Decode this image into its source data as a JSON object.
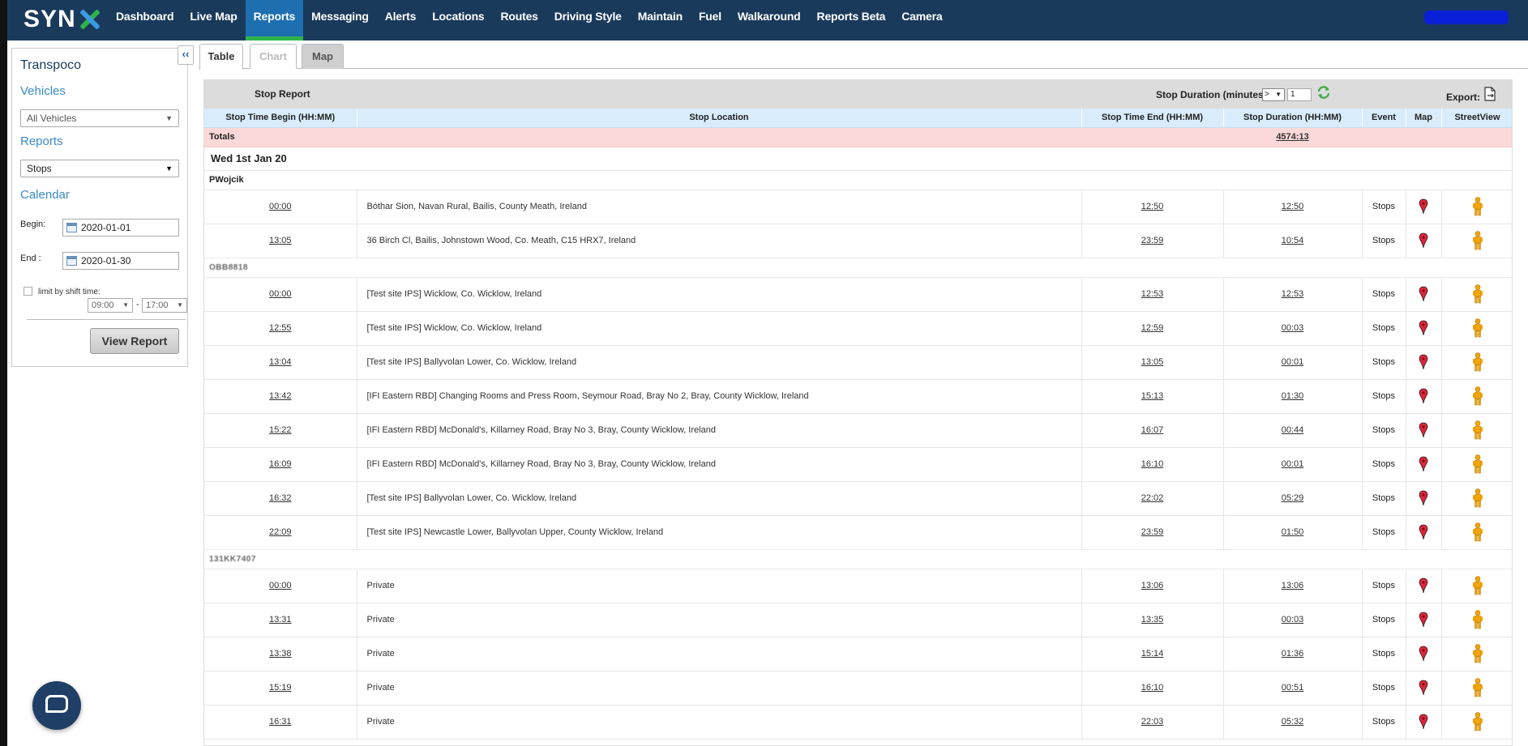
{
  "app": {
    "logo_text": "SYN",
    "nav": [
      "Dashboard",
      "Live Map",
      "Reports",
      "Messaging",
      "Alerts",
      "Locations",
      "Routes",
      "Driving Style",
      "Maintain",
      "Fuel",
      "Walkaround",
      "Reports Beta",
      "Camera"
    ],
    "active_nav": "Reports",
    "colors": {
      "nav_bg": "#1a3a5c",
      "active_tab": "#1d6fb0",
      "active_underline": "#2eb34a",
      "accent_text": "#3a8ac6",
      "totals_bg": "#fcd9d9",
      "header_bg": "#d9ecfb"
    }
  },
  "sidebar": {
    "collapse_label": "‹‹",
    "title": "Transpoco",
    "vehicles_label": "Vehicles",
    "vehicles_value": "All Vehicles",
    "reports_label": "Reports",
    "reports_value": "Stops",
    "calendar_label": "Calendar",
    "begin_label": "Begin:",
    "begin_value": "2020-01-01",
    "end_label": "End :",
    "end_value": "2020-01-30",
    "shift_label": "limit by shift time:",
    "shift_start": "09:00",
    "shift_end": "17:00",
    "view_button": "View Report"
  },
  "tabs": {
    "table": "Table",
    "chart": "Chart",
    "map": "Map"
  },
  "report": {
    "title": "Stop Report",
    "duration_label": "Stop Duration (minutes)",
    "duration_operator": ">",
    "duration_value": "1",
    "export_label": "Export:",
    "columns": [
      "Stop Time Begin (HH:MM)",
      "Stop Location",
      "Stop Time End (HH:MM)",
      "Stop Duration (HH:MM)",
      "Event",
      "Map",
      "StreetView"
    ],
    "totals_label": "Totals",
    "totals_duration": "4574:13",
    "date": "Wed 1st Jan 20",
    "groups": [
      {
        "driver": "PWojcik",
        "rows": [
          {
            "begin": "00:00",
            "location": "Bóthar Sion, Navan Rural, Bailis, County Meath, Ireland",
            "end": "12:50",
            "duration": "12:50",
            "event": "Stops"
          },
          {
            "begin": "13:05",
            "location": "36 Birch Cl, Bailis, Johnstown Wood, Co. Meath, C15 HRX7, Ireland",
            "end": "23:59",
            "duration": "10:54",
            "event": "Stops"
          }
        ]
      },
      {
        "driver": "OBB8818",
        "rows": [
          {
            "begin": "00:00",
            "location": "[Test site IPS] Wicklow, Co. Wicklow, Ireland",
            "end": "12:53",
            "duration": "12:53",
            "event": "Stops"
          },
          {
            "begin": "12:55",
            "location": "[Test site IPS] Wicklow, Co. Wicklow, Ireland",
            "end": "12:59",
            "duration": "00:03",
            "event": "Stops"
          },
          {
            "begin": "13:04",
            "location": "[Test site IPS] Ballyvolan Lower, Co. Wicklow, Ireland",
            "end": "13:05",
            "duration": "00:01",
            "event": "Stops"
          },
          {
            "begin": "13:42",
            "location": "[IFI Eastern RBD] Changing Rooms and Press Room, Seymour Road, Bray No 2, Bray, County Wicklow, Ireland",
            "end": "15:13",
            "duration": "01:30",
            "event": "Stops"
          },
          {
            "begin": "15:22",
            "location": "[IFI Eastern RBD] McDonald's, Killarney Road, Bray No 3, Bray, County Wicklow, Ireland",
            "end": "16:07",
            "duration": "00:44",
            "event": "Stops"
          },
          {
            "begin": "16:09",
            "location": "[IFI Eastern RBD] McDonald's, Killarney Road, Bray No 3, Bray, County Wicklow, Ireland",
            "end": "16:10",
            "duration": "00:01",
            "event": "Stops"
          },
          {
            "begin": "16:32",
            "location": "[Test site IPS] Ballyvolan Lower, Co. Wicklow, Ireland",
            "end": "22:02",
            "duration": "05:29",
            "event": "Stops"
          },
          {
            "begin": "22:09",
            "location": "[Test site IPS] Newcastle Lower, Ballyvolan Upper, County Wicklow, Ireland",
            "end": "23:59",
            "duration": "01:50",
            "event": "Stops"
          }
        ]
      },
      {
        "driver": "131KK7407",
        "rows": [
          {
            "begin": "00:00",
            "location": "Private",
            "end": "13:06",
            "duration": "13:06",
            "event": "Stops"
          },
          {
            "begin": "13:31",
            "location": "Private",
            "end": "13:35",
            "duration": "00:03",
            "event": "Stops"
          },
          {
            "begin": "13:38",
            "location": "Private",
            "end": "15:14",
            "duration": "01:36",
            "event": "Stops"
          },
          {
            "begin": "15:19",
            "location": "Private",
            "end": "16:10",
            "duration": "00:51",
            "event": "Stops"
          },
          {
            "begin": "16:31",
            "location": "Private",
            "end": "22:03",
            "duration": "05:32",
            "event": "Stops"
          }
        ]
      }
    ]
  },
  "icons": {
    "map": "map-pin-icon",
    "streetview": "pegman-icon",
    "refresh": "refresh-icon",
    "export": "export-icon",
    "chat": "chat-icon"
  }
}
